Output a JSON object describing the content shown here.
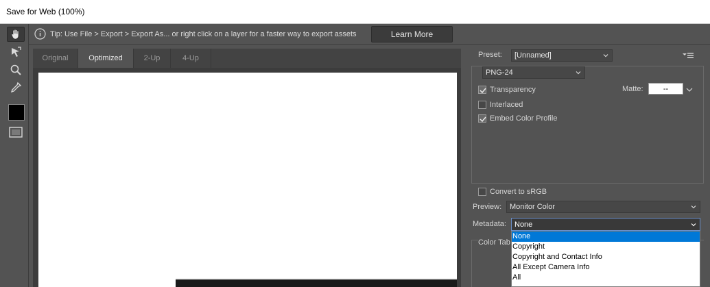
{
  "window": {
    "title": "Save for Web (100%)"
  },
  "tools": [
    {
      "name": "hand-tool",
      "icon": "hand-icon"
    },
    {
      "name": "slice-select-tool",
      "icon": "arrow-icon"
    },
    {
      "name": "zoom-tool",
      "icon": "magnifier-icon"
    },
    {
      "name": "eyedropper-tool",
      "icon": "eyedropper-icon"
    },
    {
      "name": "eyedropper-color",
      "icon": "color-swatch",
      "color": "#000000"
    },
    {
      "name": "toggle-slices",
      "icon": "slices-icon"
    }
  ],
  "tipbar": {
    "text": "Tip: Use File > Export > Export As...  or right click on a layer for a faster way to export assets",
    "learn_more": "Learn More"
  },
  "tabs": [
    "Original",
    "Optimized",
    "2-Up",
    "4-Up"
  ],
  "active_tab": "Optimized",
  "settings": {
    "preset_label": "Preset:",
    "preset_value": "[Unnamed]",
    "format": "PNG-24",
    "transparency": "Transparency",
    "transparency_checked": true,
    "interlaced": "Interlaced",
    "interlaced_checked": false,
    "embed_profile": "Embed Color Profile",
    "embed_profile_checked": true,
    "matte_label": "Matte:",
    "matte_value": "--",
    "convert_srgb": "Convert to sRGB",
    "convert_srgb_checked": false,
    "preview_label": "Preview:",
    "preview_value": "Monitor Color",
    "metadata_label": "Metadata:",
    "metadata_value": "None",
    "metadata_options": [
      "None",
      "Copyright",
      "Copyright and Contact Info",
      "All Except Camera Info",
      "All"
    ],
    "color_table": "Color Tab"
  }
}
